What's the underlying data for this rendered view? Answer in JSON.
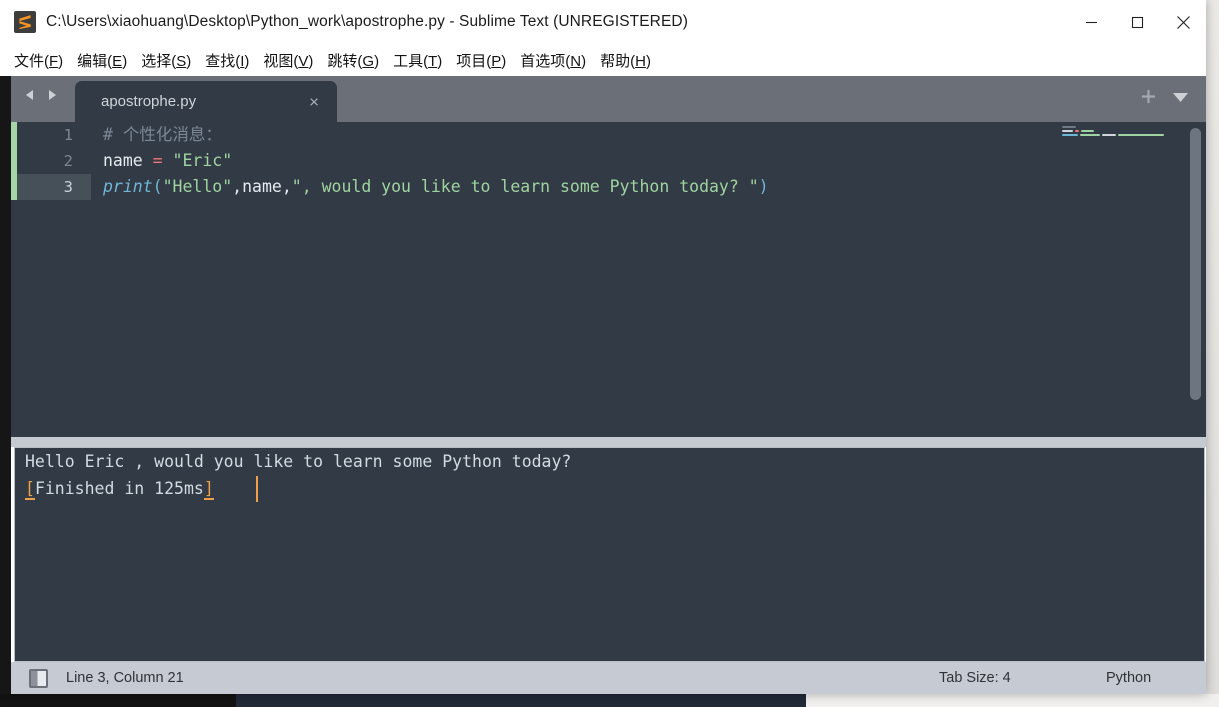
{
  "window": {
    "title": "C:\\Users\\xiaohuang\\Desktop\\Python_work\\apostrophe.py - Sublime Text (UNREGISTERED)",
    "app_logo": "sublime-text-logo",
    "controls": {
      "minimize": "minimize-icon",
      "maximize": "maximize-icon",
      "close": "close-icon"
    }
  },
  "menubar": {
    "items": [
      {
        "label": "文件(F)",
        "text": "文件(",
        "mnemonic": "F",
        "tail": ")"
      },
      {
        "label": "编辑(E)",
        "text": "编辑(",
        "mnemonic": "E",
        "tail": ")"
      },
      {
        "label": "选择(S)",
        "text": "选择(",
        "mnemonic": "S",
        "tail": ")"
      },
      {
        "label": "查找(I)",
        "text": "查找(",
        "mnemonic": "I",
        "tail": ")"
      },
      {
        "label": "视图(V)",
        "text": "视图(",
        "mnemonic": "V",
        "tail": ")"
      },
      {
        "label": "跳转(G)",
        "text": "跳转(",
        "mnemonic": "G",
        "tail": ")"
      },
      {
        "label": "工具(T)",
        "text": "工具(",
        "mnemonic": "T",
        "tail": ")"
      },
      {
        "label": "项目(P)",
        "text": "项目(",
        "mnemonic": "P",
        "tail": ")"
      },
      {
        "label": "首选项(N)",
        "text": "首选项(",
        "mnemonic": "N",
        "tail": ")"
      },
      {
        "label": "帮助(H)",
        "text": "帮助(",
        "mnemonic": "H",
        "tail": ")"
      }
    ]
  },
  "tabbar": {
    "nav_prev_icon": "chevron-left-icon",
    "nav_next_icon": "chevron-right-icon",
    "active_tab": {
      "label": "apostrophe.py",
      "close_glyph": "×"
    },
    "new_tab_icon": "plus-icon",
    "tab_menu_icon": "chevron-down-icon"
  },
  "editor": {
    "line_numbers": [
      "1",
      "2",
      "3"
    ],
    "active_line": 3,
    "lines": [
      {
        "number": "1",
        "plain": "# 个性化消息：",
        "tokens": [
          {
            "t": "# 个性化消息：",
            "c": "c-comment"
          }
        ]
      },
      {
        "number": "2",
        "plain": "name = \"Eric\"",
        "tokens": [
          {
            "t": "name ",
            "c": "c-var"
          },
          {
            "t": "=",
            "c": "c-op"
          },
          {
            "t": " ",
            "c": "c-var"
          },
          {
            "t": "\"Eric\"",
            "c": "c-string"
          }
        ]
      },
      {
        "number": "3",
        "plain": "print(\"Hello\",name,\", would you like to learn some Python today? \")",
        "tokens": [
          {
            "t": "print",
            "c": "c-func"
          },
          {
            "t": "(",
            "c": "c-paren"
          },
          {
            "t": "\"Hello\"",
            "c": "c-string"
          },
          {
            "t": ",",
            "c": "c-punct"
          },
          {
            "t": "name",
            "c": "c-var"
          },
          {
            "t": ",",
            "c": "c-punct"
          },
          {
            "t": "\", would you like to learn some Python today? \"",
            "c": "c-string"
          },
          {
            "t": ")",
            "c": "c-paren"
          }
        ]
      }
    ],
    "colors": {
      "background": "#323a45",
      "active_line": "#455059",
      "gutter_text": "#7c8693",
      "git_modified": "#a5d6a7",
      "comment": "#7b8794",
      "string": "#9fd4a0",
      "operator": "#f2777a",
      "function": "#6fb6d6",
      "text": "#e6ebf0",
      "scrollbar_thumb": "#6d7680"
    }
  },
  "console": {
    "lines": [
      {
        "text": "Hello Eric , would you like to learn some Python today?",
        "bracketed": false
      },
      {
        "text": "[Finished in 125ms]",
        "bracketed": true,
        "open": "[",
        "body": "Finished in 125ms",
        "close": "]"
      }
    ],
    "caret_color": "#f0a04b"
  },
  "statusbar": {
    "sidebar_toggle_icon": "sidebar-toggle-icon",
    "position": "Line 3, Column 21",
    "tab_size": "Tab Size: 4",
    "syntax": "Python"
  }
}
